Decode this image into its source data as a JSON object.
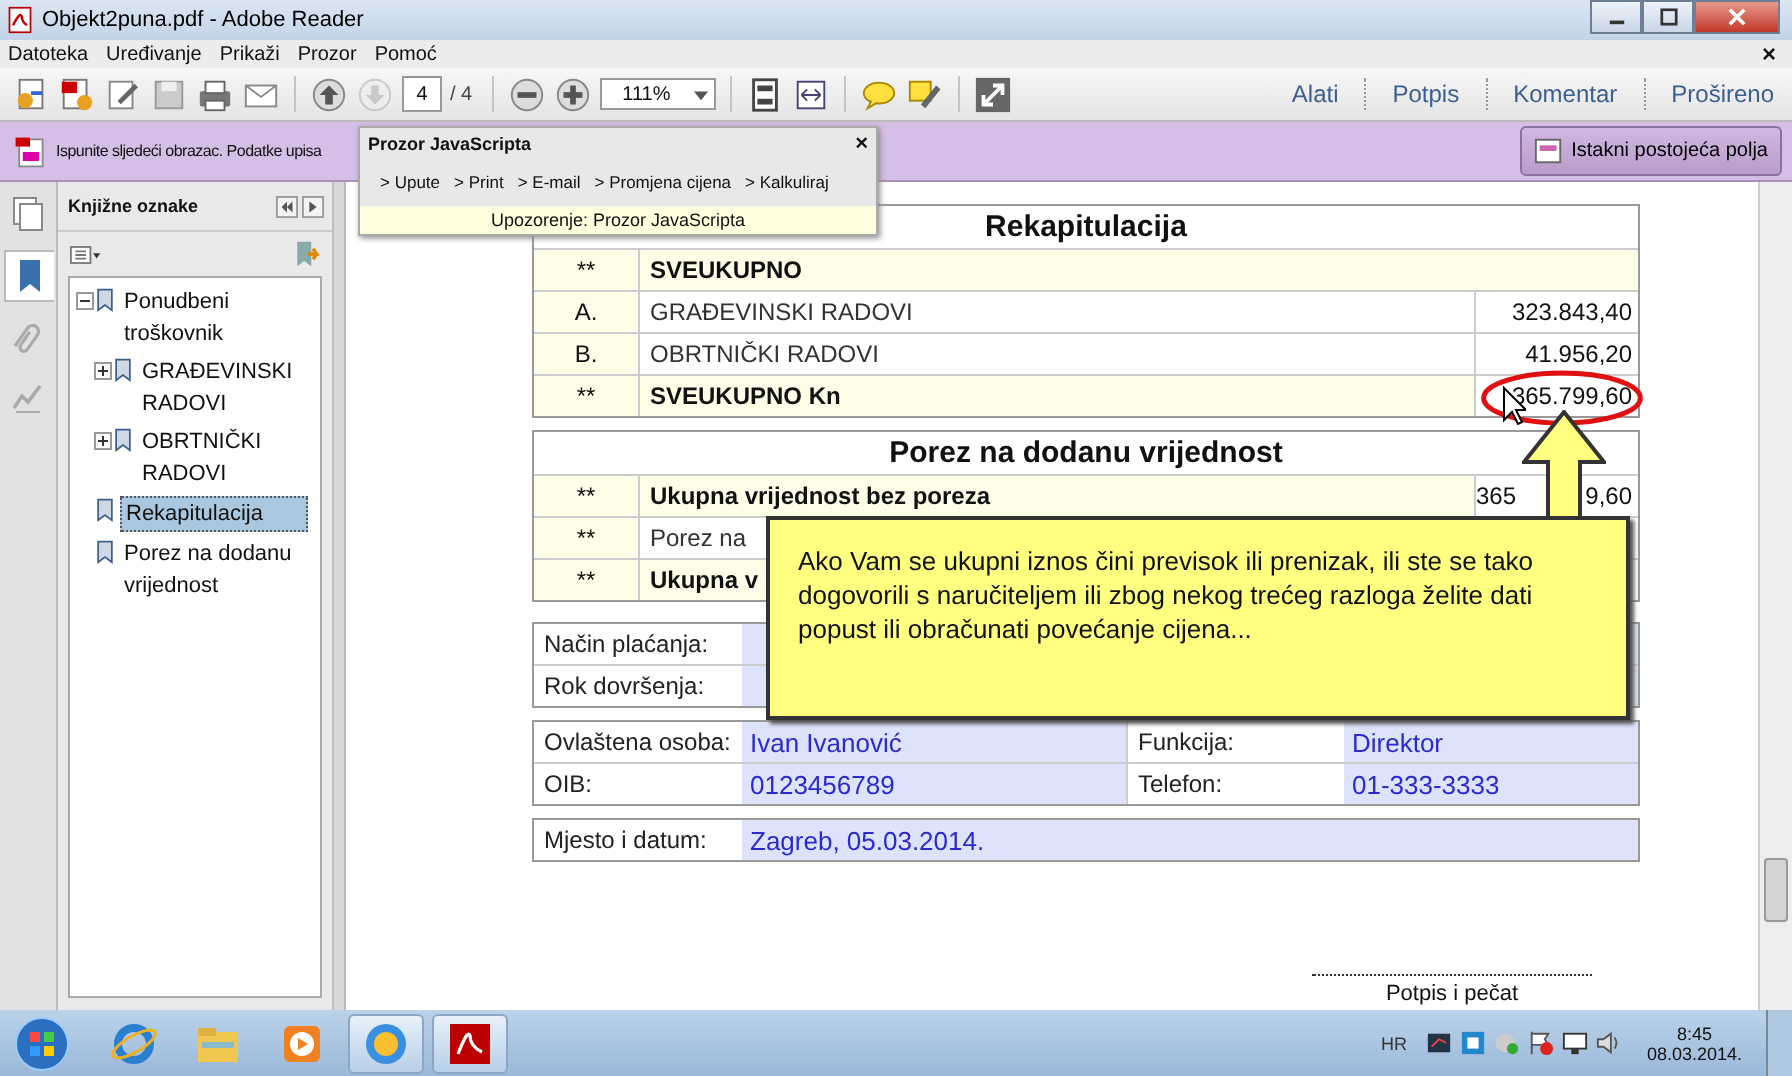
{
  "window": {
    "title": "Objekt2puna.pdf - Adobe Reader"
  },
  "menu": {
    "items": [
      "Datoteka",
      "Uređivanje",
      "Prikaži",
      "Prozor",
      "Pomoć"
    ],
    "close": "×"
  },
  "toolbar": {
    "page": "4",
    "page_total": "/ 4",
    "zoom": "111%",
    "panels": [
      "Alati",
      "Potpis",
      "Komentar",
      "Prošireno"
    ]
  },
  "form_bar": {
    "message": "Ispunite sljedeći obrazac. Podatke upisa",
    "button": "Istakni postojeća polja"
  },
  "js_window": {
    "title": "Prozor JavaScripta",
    "close": "×",
    "links": [
      "> Upute",
      "> Print",
      "> E-mail",
      "> Promjena cijena",
      "> Kalkuliraj"
    ],
    "warning": "Upozorenje: Prozor JavaScripta"
  },
  "sidebar": {
    "tabs": [
      {
        "selected": false
      },
      {
        "selected": true
      },
      {
        "selected": false
      },
      {
        "selected": false
      }
    ]
  },
  "bookmarks": {
    "title": "Knjižne oznake",
    "items": [
      {
        "label": "Ponudbeni troškovnik",
        "expanded": true,
        "selected": false,
        "children": [
          {
            "label": "GRAĐEVINSKI RADOVI",
            "expanded": false,
            "selected": false
          },
          {
            "label": "OBRTNIČKI RADOVI",
            "expanded": false,
            "selected": false
          }
        ]
      },
      {
        "label": "Rekapitulacija",
        "selected": true
      },
      {
        "label": "Porez na dodanu vrijednost",
        "selected": false
      }
    ]
  },
  "recap": {
    "title": "Rekapitulacija",
    "rows": [
      {
        "kind": "heading",
        "mark": "**",
        "label": "SVEUKUPNO"
      },
      {
        "kind": "item",
        "mark": "A.",
        "label": "GRAĐEVINSKI RADOVI",
        "value": "323.843,40"
      },
      {
        "kind": "item",
        "mark": "B.",
        "label": "OBRTNIČKI RADOVI",
        "value": "41.956,20"
      },
      {
        "kind": "total",
        "mark": "**",
        "label": "SVEUKUPNO Kn",
        "value": "365.799,60"
      }
    ]
  },
  "vat": {
    "title": "Porez na dodanu vrijednost",
    "rows": [
      {
        "kind": "total",
        "mark": "**",
        "label": "Ukupna vrijednost bez poreza",
        "value_start": "365",
        "value_end": "9,60"
      },
      {
        "kind": "item",
        "mark": "**",
        "label": "Porez na"
      },
      {
        "kind": "total",
        "mark": "**",
        "label": "Ukupna v"
      }
    ]
  },
  "payment": {
    "rows": [
      "Način plaćanja:",
      "Rok dovršenja:"
    ]
  },
  "contact": {
    "rows": [
      {
        "label": "Ovlaštena osoba:",
        "value": "Ivan Ivanović",
        "label_2": "Funkcija:",
        "value_2": "Direktor"
      },
      {
        "label": "OIB:",
        "value": "0123456789",
        "label_2": "Telefon:",
        "value_2": "01-333-3333"
      }
    ]
  },
  "place": {
    "label": "Mjesto i datum:",
    "value": "Zagreb, 05.03.2014."
  },
  "signature": "Potpis i pečat",
  "callout": {
    "text": "Ako Vam se ukupni iznos čini previsok ili prenizak, ili ste se tako dogovorili s naručiteljem ili zbog nekog trećeg razloga želite dati popust ili obračunati povećanje cijena..."
  },
  "taskbar": {
    "apps": [
      {
        "active": false
      },
      {
        "active": false
      },
      {
        "active": false
      },
      {
        "active": true
      },
      {
        "active": true
      }
    ],
    "language": "HR",
    "time": "8:45",
    "date": "08.03.2014."
  }
}
